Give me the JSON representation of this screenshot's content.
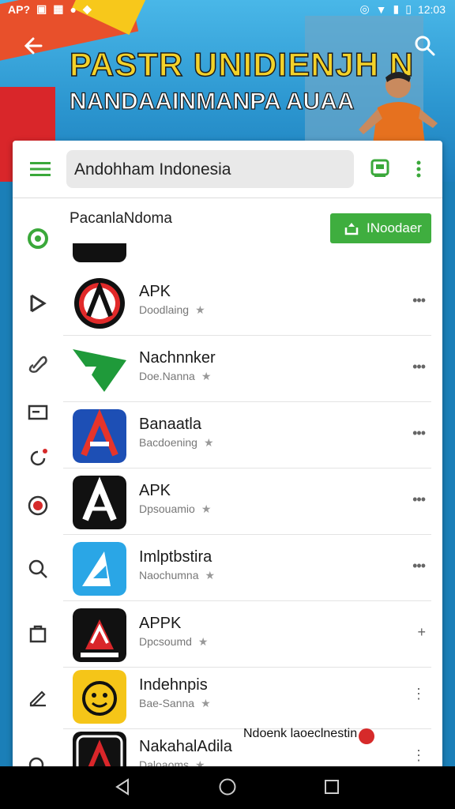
{
  "status_bar": {
    "left_text": "AP?",
    "time": "12:03",
    "icons": [
      "sim-icon",
      "mail-icon",
      "apps-icon",
      "bell-icon",
      "alarm-icon",
      "wifi-icon",
      "signal-icon",
      "battery-icon"
    ]
  },
  "banner": {
    "title_line1": "PASTR UNIDIENJH N",
    "title_line2": "NANDAAINMANPA AUAA"
  },
  "toolbar": {
    "search_value": "Andohham Indonesia"
  },
  "section": {
    "title": "PacanlaNdoma",
    "install_label": "INoodaer"
  },
  "apps": [
    {
      "title": "APK",
      "subtitle": "Doodlaing"
    },
    {
      "title": "Nachnnker",
      "subtitle": "Doe.Nanna"
    },
    {
      "title": "Banaatla",
      "subtitle": "Bacdoening"
    },
    {
      "title": "APK",
      "subtitle": "Dpsouamio"
    },
    {
      "title": "Imlptbstira",
      "subtitle": "Naochumna"
    },
    {
      "title": "APPK",
      "subtitle": "Dpcsoumd"
    },
    {
      "title": "Indehnpis",
      "subtitle": "Bae-Sanna"
    },
    {
      "title": "NakahalAdila",
      "subtitle": "Daloaoms"
    }
  ],
  "floating_label": "Ndoenk laoeclnestin",
  "colors": {
    "accent_green": "#3fae3f",
    "banner_blue": "#2b95cf",
    "title_yellow": "#f3d22a"
  }
}
